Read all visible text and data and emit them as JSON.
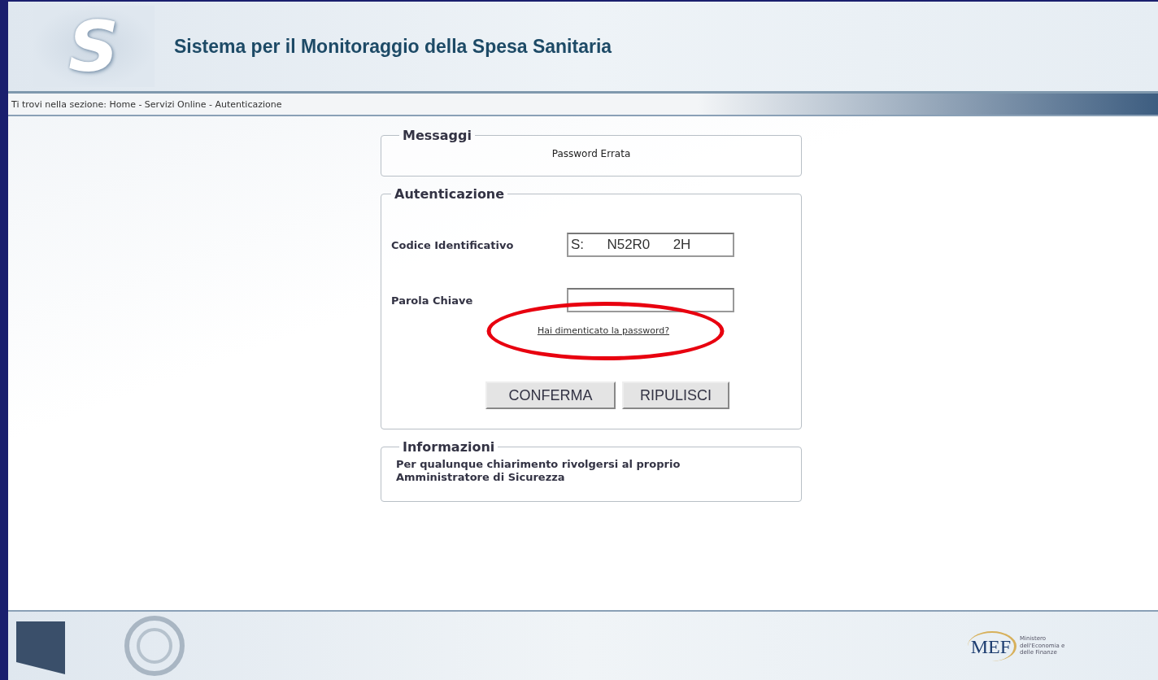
{
  "header": {
    "logo_letter": "S",
    "title": "Sistema per il Monitoraggio della Spesa Sanitaria"
  },
  "breadcrumb": "Ti trovi nella sezione: Home - Servizi Online - Autenticazione",
  "messages": {
    "legend": "Messaggi",
    "text": "Password Errata"
  },
  "auth": {
    "legend": "Autenticazione",
    "fields": [
      {
        "label": "Codice Identificativo",
        "value": "S:      N52R0      2H"
      },
      {
        "label": "Parola Chiave"
      }
    ],
    "forgot_link": "Hai dimenticato la password?",
    "highlighted": true,
    "buttons": [
      "CONFERMA",
      "RIPULISCI"
    ]
  },
  "info": {
    "legend": "Informazioni",
    "text": "Per qualunque chiarimento rivolgersi al proprio Amministratore di Sicurezza"
  },
  "footer": {
    "logo": "MEF",
    "logo_caption": "Ministero dell'Economia e delle Finanze"
  }
}
